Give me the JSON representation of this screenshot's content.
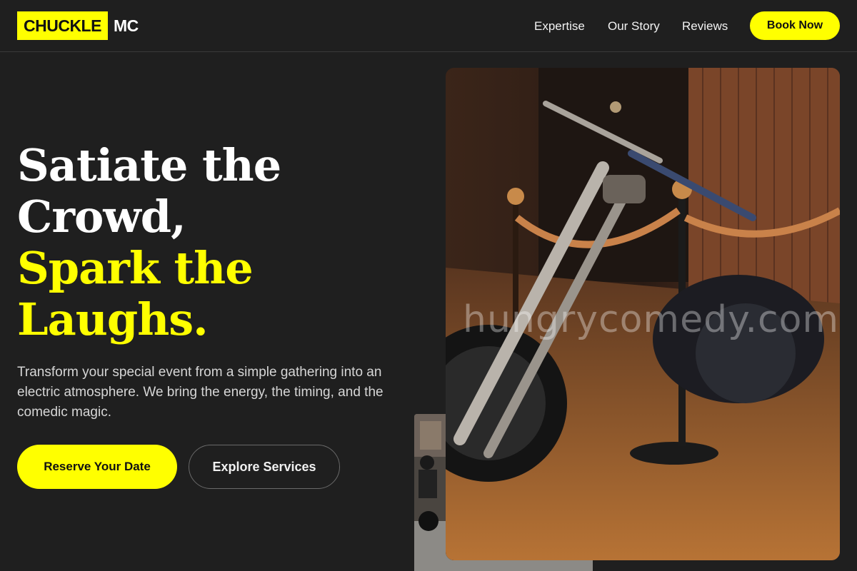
{
  "brand": {
    "highlight": "CHUCKLE",
    "rest": "MC",
    "accent": "#ffff00"
  },
  "nav": {
    "links": [
      {
        "label": "Expertise"
      },
      {
        "label": "Our Story"
      },
      {
        "label": "Reviews"
      }
    ],
    "cta": "Book Now"
  },
  "hero": {
    "headline_white": [
      "Satiate the",
      "Crowd,"
    ],
    "headline_yellow": [
      "Spark the",
      "Laughs."
    ],
    "description": "Transform your special event from a simple gathering into an electric atmosphere. We bring the energy, the timing, and the comedic magic.",
    "primary_button": "Reserve Your Date",
    "secondary_button": "Explore Services"
  },
  "images": {
    "main": {
      "subject": "motorcycle-on-display-with-rope-barriers"
    },
    "secondary": {
      "subject": "motorcyclists-on-street"
    },
    "watermark": "hungrycomedy.com"
  },
  "colors": {
    "background": "#1f1f1f",
    "accent": "#ffff00",
    "text": "#ffffff",
    "muted": "#d6d6d6"
  }
}
